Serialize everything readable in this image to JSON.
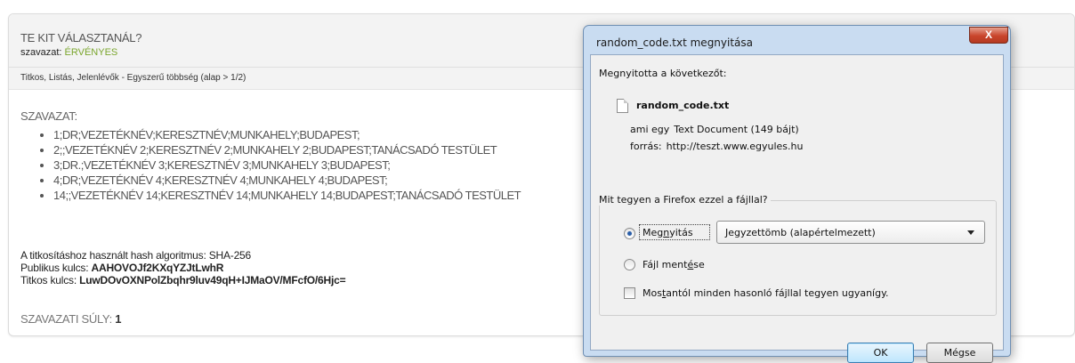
{
  "page": {
    "question_title": "TE KIT VÁLASZTANÁL?",
    "status_label": "szavazat:",
    "status_value": "ÉRVÉNYES",
    "method_text": "Titkos, Listás, Jelenlévők - Egyszerű többség (alap > 1/2)",
    "vote_heading": "SZAVAZAT:",
    "vote_items": [
      "1;DR;VEZETÉKNÉV;KERESZTNÉV;MUNKAHELY;BUDAPEST;",
      "2;;VEZETÉKNÉV 2;KERESZTNÉV 2;MUNKAHELY 2;BUDAPEST;TANÁCSADÓ TESTÜLET",
      "3;DR.;VEZETÉKNÉV 3;KERESZTNÉV 3;MUNKAHELY 3;BUDAPEST;",
      "4;DR;VEZETÉKNÉV 4;KERESZTNÉV 4;MUNKAHELY 4;BUDAPEST;",
      "14;;VEZETÉKNÉV 14;KERESZTNÉV 14;MUNKAHELY 14;BUDAPEST;TANÁCSADÓ TESTÜLET"
    ],
    "hash_line": "A titkosításhoz használt hash algoritmus: SHA-256",
    "public_key_label": "Publikus kulcs:",
    "public_key_value": "AAHOVOJf2KXqYZJtLwhR",
    "secret_key_label": "Titkos kulcs:",
    "secret_key_value": "LuwDOvOXNPolZbqhr9luv49qH+IJMaOV/MFcfO/6Hjc=",
    "weight_label": "SZAVAZATI SÚLY:",
    "weight_value": "1"
  },
  "dialog": {
    "title": "random_code.txt megnyitása",
    "close_glyph": "X",
    "opened_label": "Megnyitotta a következőt:",
    "file_name": "random_code.txt",
    "type_label": "ami egy",
    "type_value": "Text Document (149 bájt)",
    "source_label": "forrás:",
    "source_value": "http://teszt.www.egyules.hu",
    "group_legend": "Mit tegyen a Firefox ezzel a fájllal?",
    "open_option": {
      "pre": "Meg",
      "u": "n",
      "post": "yitás",
      "checked": true
    },
    "app_select_value": "Jegyzettömb (alapértelmezett)",
    "save_option": {
      "pre": "Fájl ment",
      "u": "é",
      "post": "se",
      "checked": false
    },
    "remember_option": {
      "pre": "Mos",
      "u": "t",
      "post": "antól minden hasonló fájllal tegyen ugyanígy.",
      "checked": false
    },
    "ok_label": "OK",
    "cancel_label": "Mégse"
  },
  "colors": {
    "status_ok": "#7aa52c",
    "dialog_frame": "#c9dcf1",
    "close_button": "#c9452c"
  }
}
